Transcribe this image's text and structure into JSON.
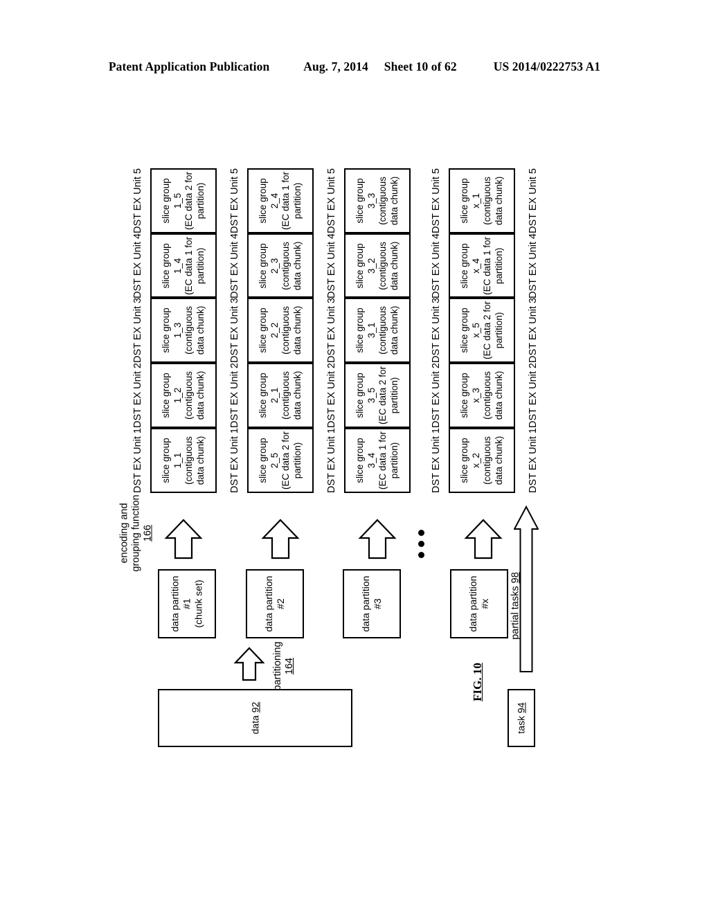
{
  "header": {
    "publication": "Patent Application Publication",
    "date": "Aug. 7, 2014",
    "sheet": "Sheet 10 of 62",
    "number": "US 2014/0222753 A1"
  },
  "figure": {
    "label": "FIG. 10",
    "encoding_function": {
      "line1": "encoding and",
      "line2": "grouping function",
      "ref": "166"
    },
    "partitioning": {
      "label": "partitioning",
      "ref": "164"
    },
    "data_block": {
      "label": "data",
      "ref": "92"
    },
    "task_block": {
      "label": "task",
      "ref": "94"
    },
    "partial_tasks": {
      "label": "partial tasks",
      "ref": "98"
    },
    "ellipsis": "•••",
    "unit_headers": [
      "DST EX Unit 1",
      "DST EX Unit 2",
      "DST EX Unit 3",
      "DST EX Unit 4",
      "DST EX Unit 5"
    ],
    "partitions": [
      {
        "name": "data partition",
        "index": "#1",
        "note": "(chunk set)",
        "cells": [
          {
            "title": "slice group",
            "id": "1_1",
            "desc_line1": "(contiguous",
            "desc_line2": "data chunk)"
          },
          {
            "title": "slice group",
            "id": "1_2",
            "desc_line1": "(contiguous",
            "desc_line2": "data chunk)"
          },
          {
            "title": "slice group",
            "id": "1_3",
            "desc_line1": "(contiguous",
            "desc_line2": "data chunk)"
          },
          {
            "title": "slice group",
            "id": "1_4",
            "desc_line1": "(EC data 1 for",
            "desc_line2": "partition)"
          },
          {
            "title": "slice group",
            "id": "1_5",
            "desc_line1": "(EC data 2 for",
            "desc_line2": "partition)"
          }
        ]
      },
      {
        "name": "data partition",
        "index": "#2",
        "note": "",
        "cells": [
          {
            "title": "slice group",
            "id": "2_5",
            "desc_line1": "(EC data 2 for",
            "desc_line2": "partition)"
          },
          {
            "title": "slice group",
            "id": "2_1",
            "desc_line1": "(contiguous",
            "desc_line2": "data chunk)"
          },
          {
            "title": "slice group",
            "id": "2_2",
            "desc_line1": "(contiguous",
            "desc_line2": "data chunk)"
          },
          {
            "title": "slice group",
            "id": "2_3",
            "desc_line1": "(contiguous",
            "desc_line2": "data chunk)"
          },
          {
            "title": "slice group",
            "id": "2_4",
            "desc_line1": "(EC data 1 for",
            "desc_line2": "partition)"
          }
        ]
      },
      {
        "name": "data partition",
        "index": "#3",
        "note": "",
        "cells": [
          {
            "title": "slice group",
            "id": "3_4",
            "desc_line1": "(EC data 1 for",
            "desc_line2": "partition)"
          },
          {
            "title": "slice group",
            "id": "3_5",
            "desc_line1": "(EC data 2 for",
            "desc_line2": "partition)"
          },
          {
            "title": "slice group",
            "id": "3_1",
            "desc_line1": "(contiguous",
            "desc_line2": "data chunk)"
          },
          {
            "title": "slice group",
            "id": "3_2",
            "desc_line1": "(contiguous",
            "desc_line2": "data chunk)"
          },
          {
            "title": "slice group",
            "id": "3_3",
            "desc_line1": "(contiguous",
            "desc_line2": "data chunk)"
          }
        ]
      },
      {
        "name": "data partition",
        "index": "#x",
        "note": "",
        "cells": [
          {
            "title": "slice group",
            "id": "x_2",
            "desc_line1": "(contiguous",
            "desc_line2": "data chunk)"
          },
          {
            "title": "slice group",
            "id": "x_3",
            "desc_line1": "(contiguous",
            "desc_line2": "data chunk)"
          },
          {
            "title": "slice group",
            "id": "x_5",
            "desc_line1": "(EC data 2 for",
            "desc_line2": "partition)"
          },
          {
            "title": "slice group",
            "id": "x_4",
            "desc_line1": "(EC data 1 for",
            "desc_line2": "partition)"
          },
          {
            "title": "slice group",
            "id": "x_1",
            "desc_line1": "(contiguous",
            "desc_line2": "data chunk)"
          }
        ]
      }
    ]
  }
}
